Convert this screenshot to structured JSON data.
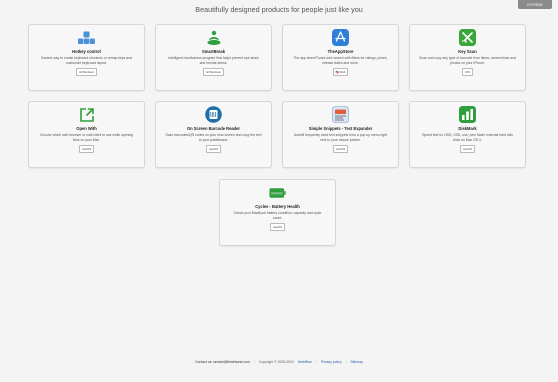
{
  "header": {
    "headline": "Beautifully designed products for people just like you",
    "top_button": "EXTREME"
  },
  "cards": [
    {
      "title": "Hotkey control",
      "description": "Easiest way to create keyboard shortcuts or remap keys and customize keyboard layout.",
      "badge": "⊞ Windows",
      "icon": "keyboard-keys-icon"
    },
    {
      "title": "SmartBreak",
      "description": "Intelligent mindfulness program that helps prevent eye strain and mental stress.",
      "badge": "⊞ Windows",
      "icon": "meditation-icon"
    },
    {
      "title": "TheAppStore",
      "description": "The app store/iTunes web search with filters for ratings, prices, release dates and more.",
      "badge": "🇺🇸 Web",
      "icon": "app-store-icon"
    },
    {
      "title": "Key Scan",
      "description": "Scan and copy any type of barcode from items, screenshots and photos on your iPhone.",
      "badge": " iOS",
      "icon": "barcode-scan-icon"
    },
    {
      "title": "Open With",
      "description": "Choose which web browser or mail client to use while opening links on your Mac.",
      "badge": " macOS",
      "icon": "open-with-arrow-icon"
    },
    {
      "title": "On Screen Barcode Reader",
      "description": "Scan barcodes/QR codes on your mac screen and copy the text to your pasteboard.",
      "badge": " macOS",
      "icon": "barcode-reader-icon"
    },
    {
      "title": "Simple Snippets - Text Expander",
      "description": "Autofill frequently used text snippets from a pop up menu right next to your mouse pointer.",
      "badge": " macOS",
      "icon": "text-expander-icon"
    },
    {
      "title": "DiskMark",
      "description": "Speed test for HDD, SSD, usb, pen/ flash/ external hard disk drive on Mac OS X.",
      "badge": " macOS",
      "icon": "disk-chart-icon"
    },
    {
      "title": "Cycles - Battery Health",
      "description": "Check your MacBook battery condition, capacity and cycle count.",
      "badge": " macOS",
      "icon": "battery-icon"
    }
  ],
  "footer": {
    "contact": "Contact us: service@thisthwest.com",
    "copyright": "Copyright © 2005-2024",
    "brand": "fetchBlue",
    "privacy": "Privacy policy",
    "sitemap": "Sitemap"
  },
  "colors": {
    "background": "#f4f4f4",
    "blue": "#4a90d9",
    "green": "#2e9e3e",
    "link": "#2a5db0"
  }
}
